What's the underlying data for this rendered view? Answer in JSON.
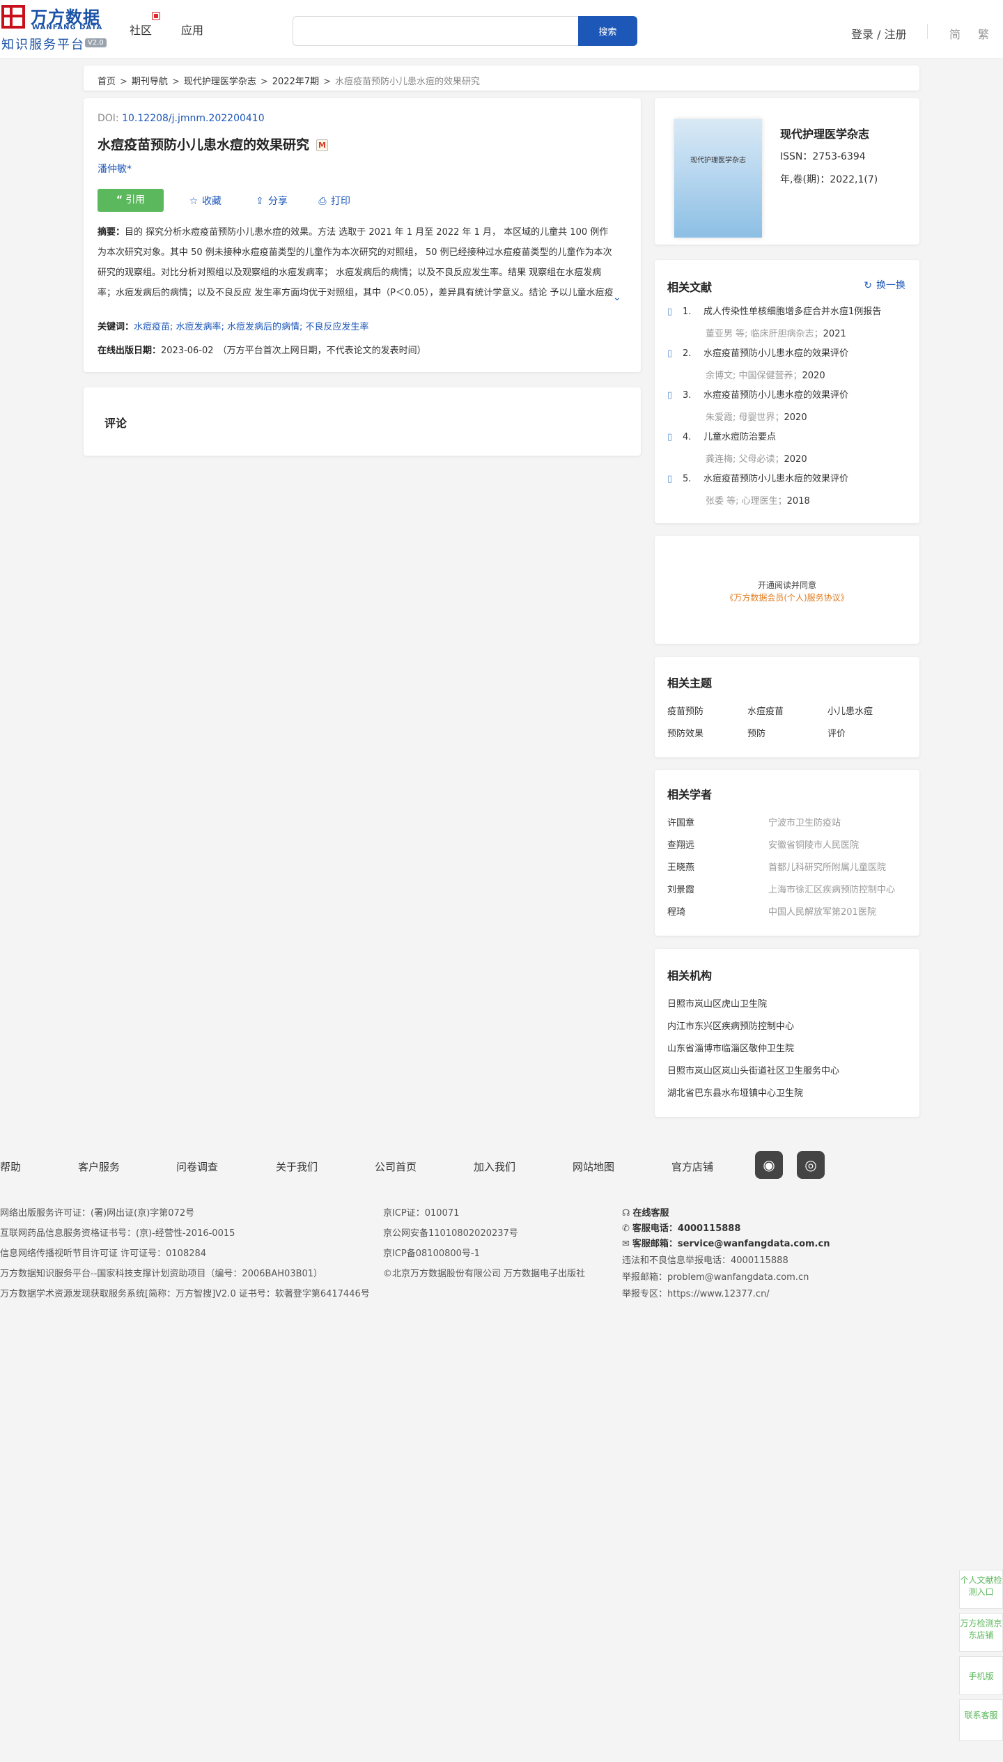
{
  "header": {
    "logo_cn": "万方数据",
    "logo_en": "WANFANG DATA",
    "logo_sub": "知识服务平台",
    "logo_version": "V2.0",
    "nav": [
      "社区",
      "应用"
    ],
    "search_placeholder": "",
    "search_button": "搜索",
    "login": "登录 / 注册",
    "lang_simplified": "简",
    "lang_traditional": "繁"
  },
  "breadcrumb": {
    "items": [
      "首页",
      "期刊导航",
      "现代护理医学杂志",
      "2022年7期"
    ],
    "current": "水痘疫苗预防小儿患水痘的效果研究"
  },
  "article": {
    "doi_label": "DOI: ",
    "doi": "10.12208/j.jmnm.202200410",
    "title": "水痘疫苗预防小儿患水痘的效果研究",
    "title_tag": "M",
    "author": "潘仲敏*",
    "actions": {
      "cite": "引用",
      "favorite": "收藏",
      "share": "分享",
      "print": "打印"
    },
    "abstract_label": "摘要：",
    "abstract": "目的 探究分析水痘疫苗预防小儿患水痘的效果。方法 选取于 2021 年 1 月至 2022 年 1 月， 本区域的儿童共 100 例作为本次研究对象。其中 50 例未接种水痘疫苗类型的儿童作为本次研究的对照组， 50 例已经接种过水痘疫苗类型的儿童作为本次研究的观察组。对比分析对照组以及观察组的水痘发病率； 水痘发病后的病情；以及不良反应发生率。结果 观察组在水痘发病率；水痘发病后的病情；以及不良反应 发生率方面均优于对照组，其中（P＜0.05），差异具有统计学意义。结论 予以儿童水痘疫苗接种，能够有 效的降低水痘发病率以及不良反应发生率，同时能够显著改善儿童在并发水痘...",
    "keywords_label": "关键词：",
    "keywords": "水痘疫苗; 水痘发病率; 水痘发病后的病情; 不良反应发生率",
    "pub_label": "在线出版日期：",
    "pub_date": "2023-06-02",
    "pub_note": "（万方平台首次上网日期，不代表论文的发表时间）"
  },
  "comment": {
    "title": "评论"
  },
  "journal": {
    "cover_text": "现代护理医学杂志",
    "name": "现代护理医学杂志",
    "issn": "ISSN：2753-6394",
    "volume": "年,卷(期)：2022,1(7)"
  },
  "related_docs": {
    "title": "相关文献",
    "refresh": "换一换",
    "items": [
      {
        "no": "1.",
        "title": "成人传染性单核细胞增多症合并水痘1例报告",
        "meta": "董亚男 等; 临床肝胆病杂志；",
        "year": "2021"
      },
      {
        "no": "2.",
        "title": "水痘疫苗预防小儿患水痘的效果评价",
        "meta": "余博文; 中国保健营养；",
        "year": "2020"
      },
      {
        "no": "3.",
        "title": "水痘疫苗预防小儿患水痘的效果评价",
        "meta": "朱爱霞; 母婴世界；",
        "year": "2020"
      },
      {
        "no": "4.",
        "title": "儿童水痘防治要点",
        "meta": "龚连梅; 父母必读；",
        "year": "2020"
      },
      {
        "no": "5.",
        "title": "水痘疫苗预防小儿患水痘的效果评价",
        "meta": "张委 等; 心理医生；",
        "year": "2018"
      }
    ]
  },
  "promo": {
    "line1": "开通阅读并同意",
    "line2": "《万方数据会员(个人)服务协议》"
  },
  "topics": {
    "title": "相关主题",
    "items": [
      "疫苗预防",
      "水痘疫苗",
      "小儿患水痘",
      "预防效果",
      "预防",
      "评价"
    ]
  },
  "scholars": {
    "title": "相关学者",
    "items": [
      {
        "name": "许国章",
        "org": "宁波市卫生防疫站"
      },
      {
        "name": "查翔远",
        "org": "安徽省铜陵市人民医院"
      },
      {
        "name": "王晓燕",
        "org": "首都儿科研究所附属儿童医院"
      },
      {
        "name": "刘景霞",
        "org": "上海市徐汇区疾病预防控制中心"
      },
      {
        "name": "程琦",
        "org": "中国人民解放军第201医院"
      }
    ]
  },
  "institutions": {
    "title": "相关机构",
    "items": [
      "日照市岚山区虎山卫生院",
      "内江市东兴区疾病预防控制中心",
      "山东省淄博市临淄区敬仲卫生院",
      "日照市岚山区岚山头街道社区卫生服务中心",
      "湖北省巴东县水布垭镇中心卫生院"
    ]
  },
  "footer": {
    "nav": [
      "帮助",
      "客户服务",
      "问卷调查",
      "关于我们",
      "公司首页",
      "加入我们",
      "网站地图",
      "官方店铺"
    ],
    "social": [
      "weibo-icon",
      "wechat-icon"
    ],
    "col1": [
      "网络出版服务许可证：(署)网出证(京)字第072号",
      "互联网药品信息服务资格证书号：(京)-经营性-2016-0015",
      "信息网络传播视听节目许可证 许可证号：0108284",
      "万方数据知识服务平台--国家科技支撑计划资助项目（编号：2006BAH03B01）",
      "万方数据学术资源发现获取服务系统[简称：万方智搜]V2.0 证书号：软著登字第6417446号"
    ],
    "col2": [
      "京ICP证：010071",
      "京公网安备11010802020237号",
      "京ICP备08100800号-1",
      "©北京万方数据股份有限公司 万方数据电子出版社"
    ],
    "online_service": "在线客服",
    "phone_label": "客服电话：",
    "phone": "4000115888",
    "email_label": "客服邮箱：",
    "email": "service@wanfangdata.com.cn",
    "report_phone": "违法和不良信息举报电话：4000115888",
    "report_email": "举报邮箱：problem@wanfangdata.com.cn",
    "report_site": "举报专区：https://www.12377.cn/"
  },
  "sidebar_float": [
    "个人文献检测入口",
    "万方检测京东店铺",
    "手机版",
    "联系客服"
  ],
  "colors": {
    "brand": "#1d57b8",
    "green": "#5cb85c",
    "logo_red": "#c8101d",
    "promo_orange": "#e07b1f"
  }
}
